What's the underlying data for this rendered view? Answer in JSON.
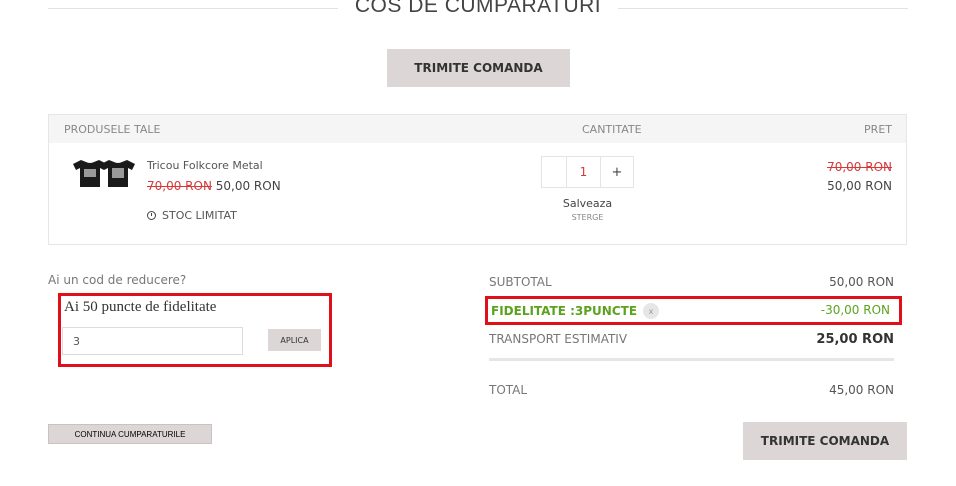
{
  "page": {
    "title": "COS DE CUMPARATURI"
  },
  "actions": {
    "submit_order_top": "TRIMITE COMANDA",
    "submit_order_bottom": "TRIMITE COMANDA",
    "continue_shopping": "CONTINUA CUMPARATURILE"
  },
  "cart": {
    "headers": {
      "products": "PRODUSELE TALE",
      "quantity": "CANTITATE",
      "price": "PRET"
    },
    "items": [
      {
        "name": "Tricou Folkcore Metal",
        "old_price": "70,00 RON",
        "new_price": "50,00 RON",
        "stock": "STOC LIMITAT",
        "quantity": "1",
        "increment": "+",
        "save_label": "Salveaza",
        "delete_label": "STERGE",
        "price_old": "70,00 RON",
        "price_new": "50,00 RON",
        "image_icon": "tshirt-icon"
      }
    ]
  },
  "discount": {
    "question": "Ai un cod de reducere?",
    "fidelity_text": "Ai 50 puncte de fidelitate",
    "input_value": "3",
    "apply_label": "APLICA"
  },
  "totals": {
    "subtotal_label": "SUBTOTAL",
    "subtotal_value": "50,00 RON",
    "fidelity_label": "FIDELITATE :3PUNCTE",
    "fidelity_remove": "x",
    "fidelity_value": "-30,00 RON",
    "shipping_label": "TRANSPORT ESTIMATIV",
    "shipping_value": "25,00 RON",
    "total_label": "TOTAL",
    "total_value": "45,00 RON"
  },
  "colors": {
    "accent_red": "#d43a3a",
    "highlight_box": "#e0101a",
    "fidelity_green": "#5ba31f",
    "button_grey": "#dcd6d6"
  }
}
